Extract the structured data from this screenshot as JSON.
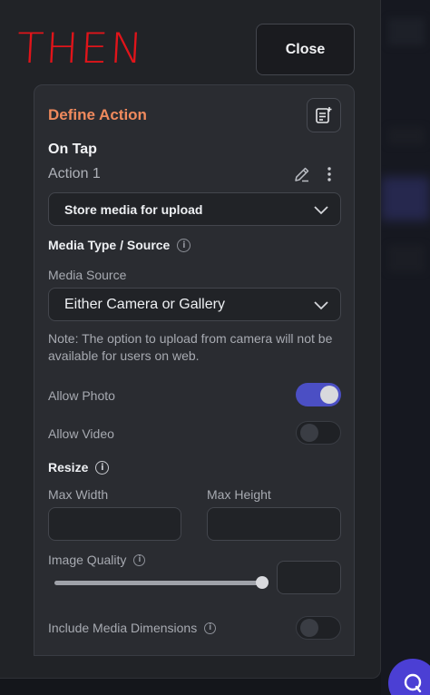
{
  "annotation": {
    "then_label": "THEN"
  },
  "header": {
    "close_label": "Close"
  },
  "card": {
    "title": "Define Action",
    "trigger": "On Tap",
    "action_name": "Action 1",
    "action_type": "Store media for upload",
    "media_type_heading": "Media Type / Source",
    "media_source_label": "Media Source",
    "media_source_value": "Either Camera or Gallery",
    "note": "Note: The option to upload from camera will not be available for users on web.",
    "allow_photo_label": "Allow Photo",
    "allow_photo": true,
    "allow_video_label": "Allow Video",
    "allow_video": false,
    "resize_heading": "Resize",
    "max_width_label": "Max Width",
    "max_width_value": "",
    "max_height_label": "Max Height",
    "max_height_value": "",
    "image_quality_label": "Image Quality",
    "image_quality_value": "",
    "image_quality_slider": 1.0,
    "include_dims_label": "Include Media Dimensions",
    "include_dims": false
  },
  "colors": {
    "accent_title": "#f08a5d",
    "toggle_on": "#4b4fc4",
    "then_red": "#e0141a",
    "fab": "#4b3fd4"
  },
  "icons": [
    "add-note-icon",
    "pencil-icon",
    "more-vertical-icon",
    "chevron-down-icon",
    "info-icon",
    "chat-icon"
  ]
}
